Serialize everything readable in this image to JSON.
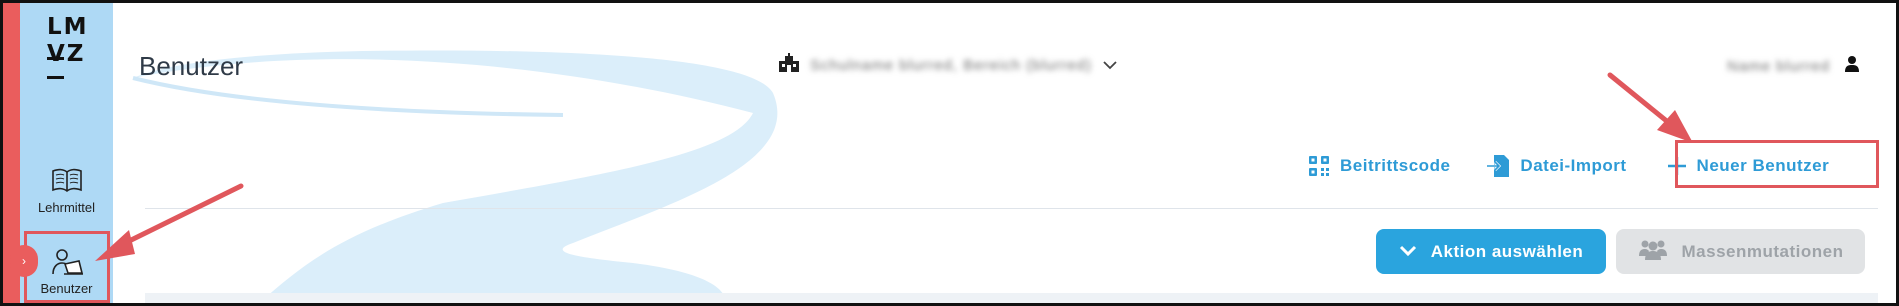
{
  "sidebar": {
    "logo": [
      "LM",
      "VZ"
    ],
    "items": [
      {
        "label": "Lehrmittel",
        "icon": "book-icon"
      },
      {
        "label": "Benutzer",
        "icon": "user-laptop-icon"
      }
    ]
  },
  "header": {
    "title": "Benutzer",
    "school_name": "Schulname blurred, Bereich (blurred)",
    "user_name": "Name blurred"
  },
  "actions": {
    "join_code": "Beitrittscode",
    "file_import": "Datei-Import",
    "new_user": "Neuer Benutzer"
  },
  "toolbar": {
    "select_action": "Aktion auswählen",
    "mass_mutations": "Massenmutationen"
  },
  "colors": {
    "accent": "#2aa4de",
    "sidebar": "#aed9f5",
    "annotation": "#e0575c"
  }
}
